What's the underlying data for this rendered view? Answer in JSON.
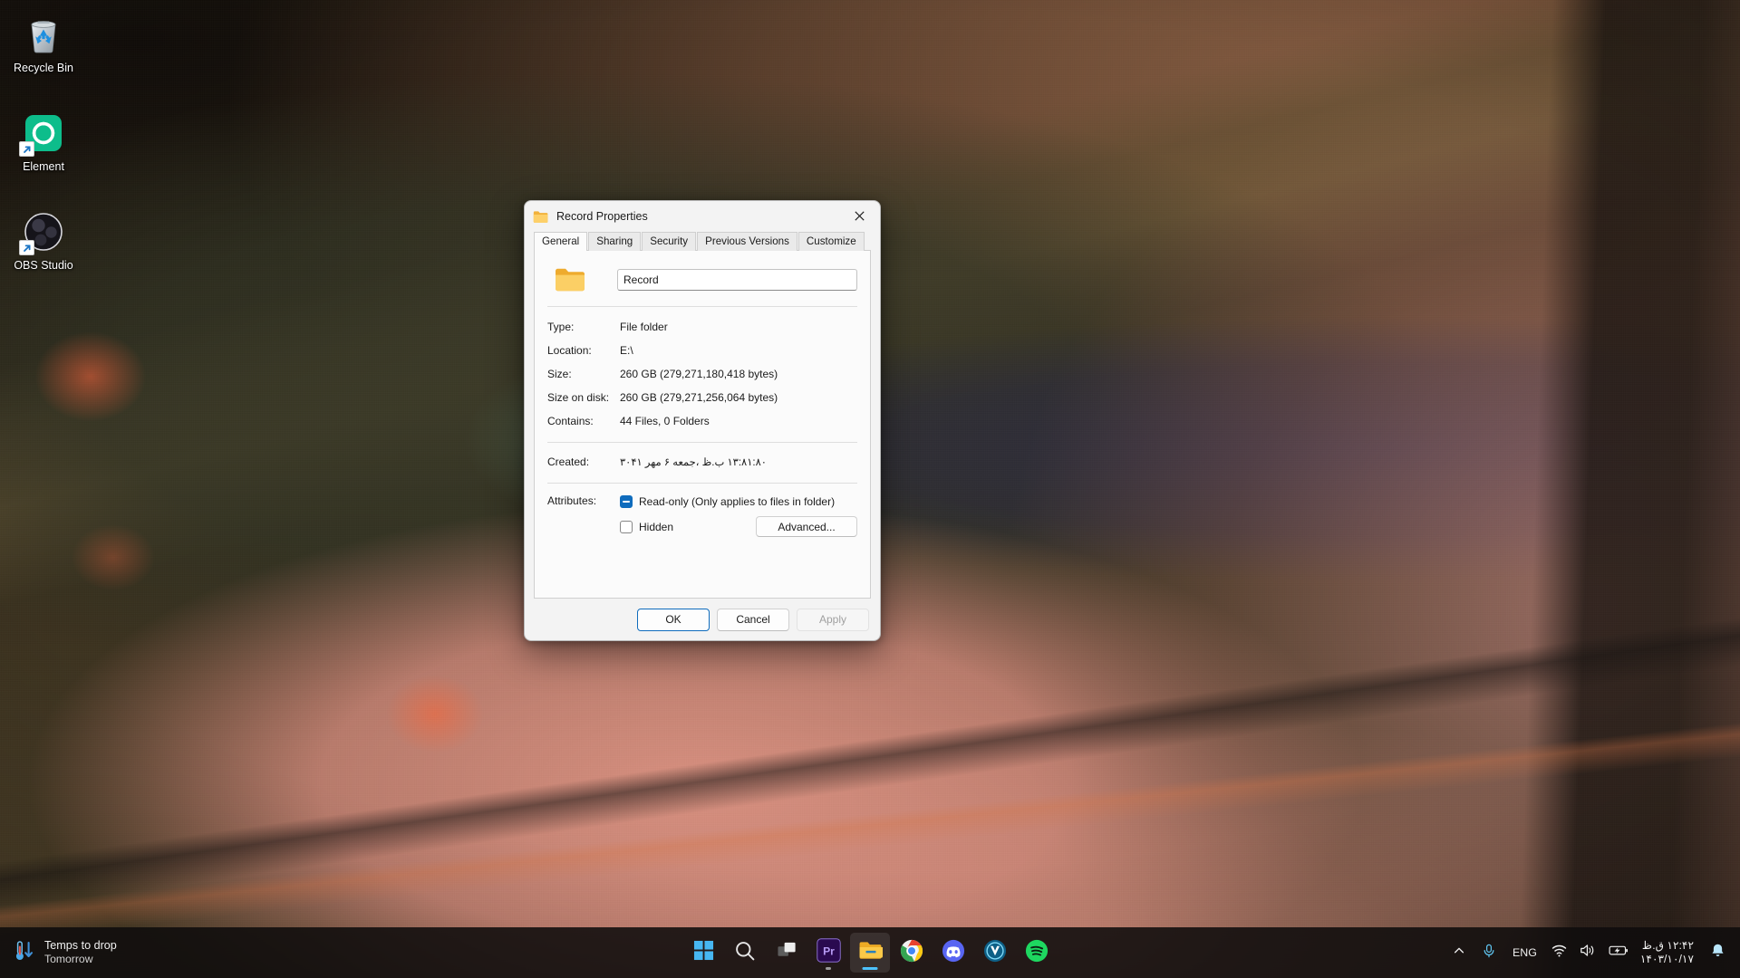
{
  "desktop": {
    "icons": [
      {
        "name": "recycle-bin",
        "label": "Recycle Bin",
        "shortcut": false
      },
      {
        "name": "element",
        "label": "Element",
        "shortcut": true
      },
      {
        "name": "obs-studio",
        "label": "OBS Studio",
        "shortcut": true
      }
    ]
  },
  "dialog": {
    "title": "Record Properties",
    "close_label": "Close",
    "tabs": [
      {
        "label": "General",
        "active": true
      },
      {
        "label": "Sharing",
        "active": false
      },
      {
        "label": "Security",
        "active": false
      },
      {
        "label": "Previous Versions",
        "active": false
      },
      {
        "label": "Customize",
        "active": false
      }
    ],
    "name_field": {
      "value": "Record",
      "placeholder": ""
    },
    "properties": [
      {
        "label": "Type:",
        "value": "File folder"
      },
      {
        "label": "Location:",
        "value": "E:\\"
      },
      {
        "label": "Size:",
        "value": "260 GB (279,271,180,418 bytes)"
      },
      {
        "label": "Size on disk:",
        "value": "260 GB (279,271,256,064 bytes)"
      },
      {
        "label": "Contains:",
        "value": "44 Files, 0 Folders"
      }
    ],
    "created": {
      "label": "Created:",
      "value": "۰۸:۱۸:۳۱ ب.ظ ،جمعه ۶ مهر ۱۴۰۳"
    },
    "attributes": {
      "label": "Attributes:",
      "readonly": {
        "label": "Read-only (Only applies to files in folder)",
        "state": "indeterminate"
      },
      "hidden": {
        "label": "Hidden",
        "state": "unchecked"
      },
      "advanced_label": "Advanced..."
    },
    "buttons": {
      "ok": "OK",
      "cancel": "Cancel",
      "apply": "Apply"
    },
    "accent_color": "#0f6cbd"
  },
  "taskbar": {
    "weather": {
      "title": "Temps to drop",
      "subtitle": "Tomorrow",
      "icon": "thermometer-down-icon"
    },
    "center_items": [
      {
        "name": "start-button",
        "icon": "windows-logo-icon",
        "active": false,
        "indicator": "none"
      },
      {
        "name": "search-button",
        "icon": "search-icon",
        "active": false,
        "indicator": "none"
      },
      {
        "name": "task-view-button",
        "icon": "task-view-icon",
        "active": false,
        "indicator": "none"
      },
      {
        "name": "premiere-pro-button",
        "icon": "premiere-pro-icon",
        "active": false,
        "indicator": "dot"
      },
      {
        "name": "file-explorer-button",
        "icon": "folder-icon",
        "active": true,
        "indicator": "wide"
      },
      {
        "name": "chrome-button",
        "icon": "chrome-icon",
        "active": false,
        "indicator": "none"
      },
      {
        "name": "discord-button",
        "icon": "discord-icon",
        "active": false,
        "indicator": "none"
      },
      {
        "name": "v2ray-button",
        "icon": "v2ray-icon",
        "active": false,
        "indicator": "none"
      },
      {
        "name": "spotify-button",
        "icon": "spotify-icon",
        "active": false,
        "indicator": "none"
      }
    ],
    "tray": {
      "overflow_icon": "chevron-up-icon",
      "microphone_icon": "microphone-icon",
      "language": "ENG",
      "wifi_icon": "wifi-icon",
      "volume_icon": "speaker-icon",
      "battery_icon": "battery-charging-icon",
      "clock_time": "۱۲:۴۲ ق.ظ",
      "clock_date": "۱۴۰۳/۱۰/۱۷",
      "notification_icon": "bell-icon"
    }
  }
}
